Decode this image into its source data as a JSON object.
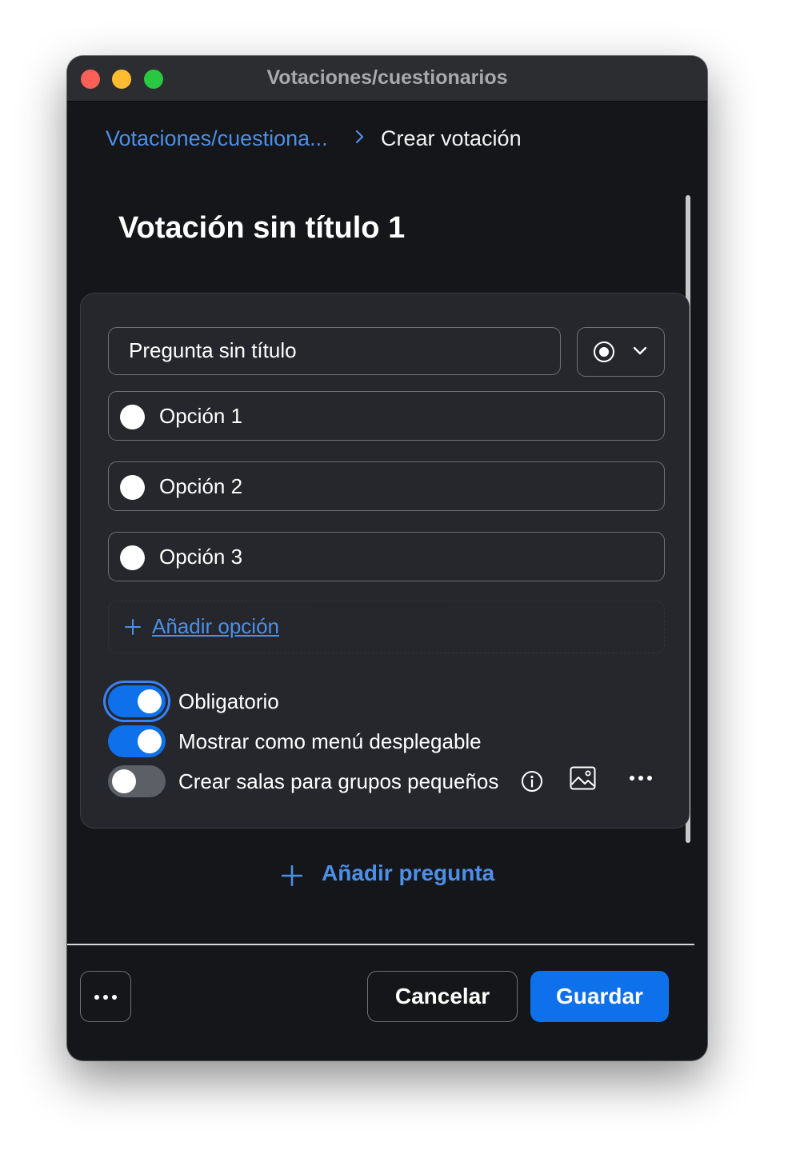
{
  "window": {
    "title": "Votaciones/cuestionarios"
  },
  "breadcrumb": {
    "parent": "Votaciones/cuestiona...",
    "current": "Crear votación"
  },
  "poll": {
    "title": "Votación sin título 1"
  },
  "question": {
    "title": "Pregunta sin título",
    "type_icon": "radio-button-icon",
    "options": [
      "Opción 1",
      "Opción 2",
      "Opción 3"
    ],
    "add_option_label": "Añadir opción",
    "settings": {
      "required": {
        "label": "Obligatorio",
        "on": true
      },
      "dropdown": {
        "label": "Mostrar como menú desplegable",
        "on": true
      },
      "breakout_rooms": {
        "label": "Crear salas para grupos pequeños",
        "on": false
      }
    }
  },
  "add_question_label": "Añadir pregunta",
  "footer": {
    "cancel_label": "Cancelar",
    "save_label": "Guardar"
  },
  "colors": {
    "accent": "#0e71eb",
    "link": "#4c8fe8",
    "background": "#151619",
    "card": "#25272c"
  }
}
